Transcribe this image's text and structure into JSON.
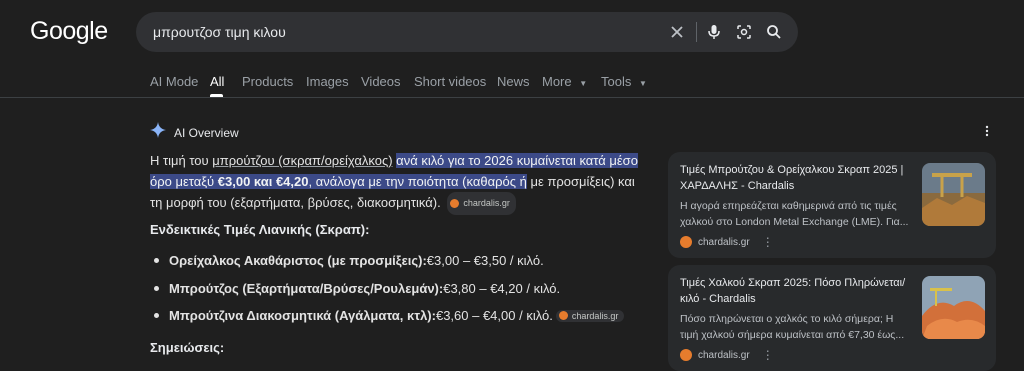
{
  "logo": "Google",
  "search": {
    "query": "μπρουτζοσ τιμη κιλου"
  },
  "tabs": [
    {
      "label": "AI Mode"
    },
    {
      "label": "All"
    },
    {
      "label": "Products"
    },
    {
      "label": "Images"
    },
    {
      "label": "Videos"
    },
    {
      "label": "Short videos"
    },
    {
      "label": "News"
    },
    {
      "label": "More"
    },
    {
      "label": "Tools"
    }
  ],
  "overview": {
    "title": "AI Overview",
    "p1_a": "Η τιμή του ",
    "p1_b": "μπρούτζου (σκραπ/ορείχαλκος)",
    "p1_c": " ",
    "p1_d": "ανά κιλό για το 2026 κυμαίνεται κατά μέσο όρο μεταξύ ",
    "p1_e": "€3,00 και €4,20",
    "p1_f": ", ανάλογα με την ποιότητα (καθαρός ή",
    "p1_g": " με προσμίξεις) και τη μορφή του (εξαρτήματα, βρύσες, διακοσμητικά).",
    "chip": "chardalis.gr",
    "heading1": "Ενδεικτικές Τιμές Λιανικής (Σκραπ):",
    "bullets": [
      {
        "bold": "Ορείχαλκος Ακαθάριστος (με προσμίξεις):",
        "text": " €3,00 – €3,50 / κιλό."
      },
      {
        "bold": "Μπρούτζος (Εξαρτήματα/Βρύσες/Ρουλεμάν):",
        "text": " €3,80 – €4,20 / κιλό."
      },
      {
        "bold": "Μπρούτζινα Διακοσμητικά (Αγάλματα, κτλ):",
        "text": " €3,60 – €4,00 / κιλό."
      }
    ],
    "heading2": "Σημειώσεις:"
  },
  "cards": [
    {
      "title": "Τιμές Μπρούτζου & Ορείχαλκου Σκραπ 2025 | ΧΑΡΔΑΛΗΣ - Chardalis",
      "desc": "Η αγορά επηρεάζεται καθημερινά από τις τιμές χαλκού στο London Metal Exchange (LME). Για...",
      "source": "chardalis.gr"
    },
    {
      "title": "Τιμές Χαλκού Σκραπ 2025: Πόσο Πληρώνεται/κιλό - Chardalis",
      "desc": "Πόσο πληρώνεται ο χαλκός το κιλό σήμερα; Η τιμή χαλκού σήμερα κυμαίνεται από €7,30 έως...",
      "source": "chardalis.gr"
    }
  ],
  "colors": {
    "highlight": "#3c4a88",
    "background": "#1f1f1f",
    "search_bg": "#303134"
  }
}
